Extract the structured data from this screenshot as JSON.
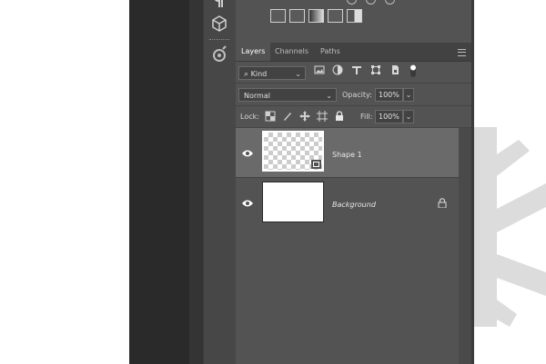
{
  "colors": {
    "panel": "#535353",
    "selected_layer": "#6a6a6a",
    "tab_bar": "#424242",
    "canvas": "#ffffff"
  },
  "toolbar": {
    "icons": [
      "paragraph-icon",
      "3d-cube-icon",
      "brush-settings-icon"
    ]
  },
  "adjustments": {
    "icons": [
      "curves-icon",
      "exposure-icon",
      "gradient-map-icon",
      "photo-filter-icon",
      "levels-icon"
    ]
  },
  "layers_panel": {
    "tabs": [
      {
        "label": "Layers"
      },
      {
        "label": "Channels"
      },
      {
        "label": "Paths"
      }
    ],
    "filter": {
      "label": "Kind",
      "icons": [
        "image-filter-icon",
        "adjustment-filter-icon",
        "type-filter-icon",
        "shape-filter-icon",
        "smart-object-filter-icon",
        "filter-toggle-icon"
      ]
    },
    "blend_mode": "Normal",
    "opacity": {
      "label": "Opacity:",
      "value": "100%"
    },
    "lock": {
      "label": "Lock:",
      "icons": [
        "lock-transparent-icon",
        "lock-pixels-icon",
        "lock-position-icon",
        "lock-artboard-icon",
        "lock-all-icon"
      ]
    },
    "fill": {
      "label": "Fill:",
      "value": "100%"
    },
    "layers": [
      {
        "name": "Shape 1",
        "selected": true
      },
      {
        "name": "Background",
        "selected": false
      }
    ]
  }
}
